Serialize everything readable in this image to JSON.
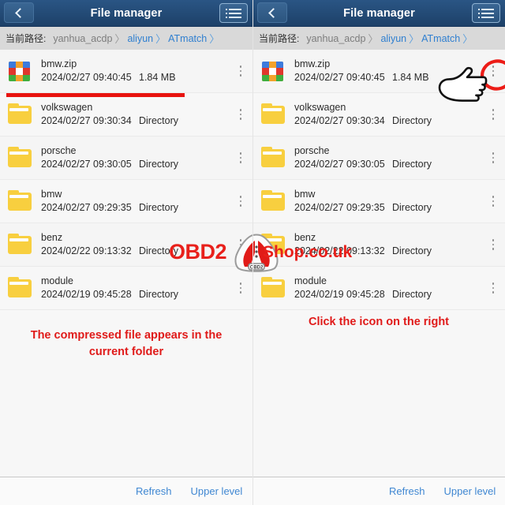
{
  "panels": [
    {
      "id": "left",
      "header": {
        "title": "File manager",
        "back_icon": "chevron-left-icon",
        "menu_icon": "list-menu-icon"
      },
      "breadcrumb": {
        "label": "当前路径:",
        "segments": [
          {
            "text": "yanhua_acdp",
            "link": false
          },
          {
            "text": "aliyun",
            "link": true
          },
          {
            "text": "ATmatch",
            "link": true
          }
        ],
        "separator": "〉"
      },
      "files": [
        {
          "icon": "zip-archive-icon",
          "name": "bmw.zip",
          "date": "2024/02/27 09:40:45",
          "size": "1.84 MB",
          "underlined": true
        },
        {
          "icon": "folder-icon",
          "name": "volkswagen",
          "date": "2024/02/27 09:30:34",
          "size": "Directory",
          "underlined": false
        },
        {
          "icon": "folder-icon",
          "name": "porsche",
          "date": "2024/02/27 09:30:05",
          "size": "Directory",
          "underlined": false
        },
        {
          "icon": "folder-icon",
          "name": "bmw",
          "date": "2024/02/27 09:29:35",
          "size": "Directory",
          "underlined": false
        },
        {
          "icon": "folder-icon",
          "name": "benz",
          "date": "2024/02/22 09:13:32",
          "size": "Directory",
          "underlined": false
        },
        {
          "icon": "folder-icon",
          "name": "module",
          "date": "2024/02/19 09:45:28",
          "size": "Directory",
          "underlined": false
        }
      ],
      "caption": "The compressed file appears in the current folder",
      "footer": {
        "refresh": "Refresh",
        "upper": "Upper level"
      }
    },
    {
      "id": "right",
      "header": {
        "title": "File manager",
        "back_icon": "chevron-left-icon",
        "menu_icon": "list-menu-icon"
      },
      "breadcrumb": {
        "label": "当前路径:",
        "segments": [
          {
            "text": "yanhua_acdp",
            "link": false
          },
          {
            "text": "aliyun",
            "link": true
          },
          {
            "text": "ATmatch",
            "link": true
          }
        ],
        "separator": "〉"
      },
      "files": [
        {
          "icon": "zip-archive-icon",
          "name": "bmw.zip",
          "date": "2024/02/27 09:40:45",
          "size": "1.84 MB",
          "underlined": false
        },
        {
          "icon": "folder-icon",
          "name": "volkswagen",
          "date": "2024/02/27 09:30:34",
          "size": "Directory",
          "underlined": false
        },
        {
          "icon": "folder-icon",
          "name": "porsche",
          "date": "2024/02/27 09:30:05",
          "size": "Directory",
          "underlined": false
        },
        {
          "icon": "folder-icon",
          "name": "bmw",
          "date": "2024/02/27 09:29:35",
          "size": "Directory",
          "underlined": false
        },
        {
          "icon": "folder-icon",
          "name": "benz",
          "date": "2024/02/22 09:13:32",
          "size": "Directory",
          "underlined": false
        },
        {
          "icon": "folder-icon",
          "name": "module",
          "date": "2024/02/19 09:45:28",
          "size": "Directory",
          "underlined": false
        }
      ],
      "caption": "Click the icon on the right",
      "footer": {
        "refresh": "Refresh",
        "upper": "Upper level"
      }
    }
  ],
  "watermark": {
    "brand": "OBD2",
    "suffix": "Shop.co.uk",
    "badge": "OBD2",
    "color": "#e8201b"
  },
  "annotations": {
    "hand_cursor": "pointing-hand-cursor",
    "highlight_circle": "red-circle-highlight",
    "underline": "red-underline"
  },
  "colors": {
    "header_blue": "#234a75",
    "accent_red": "#e8201b",
    "link_blue": "#3f87d2",
    "folder_yellow": "#f8cf3f"
  }
}
